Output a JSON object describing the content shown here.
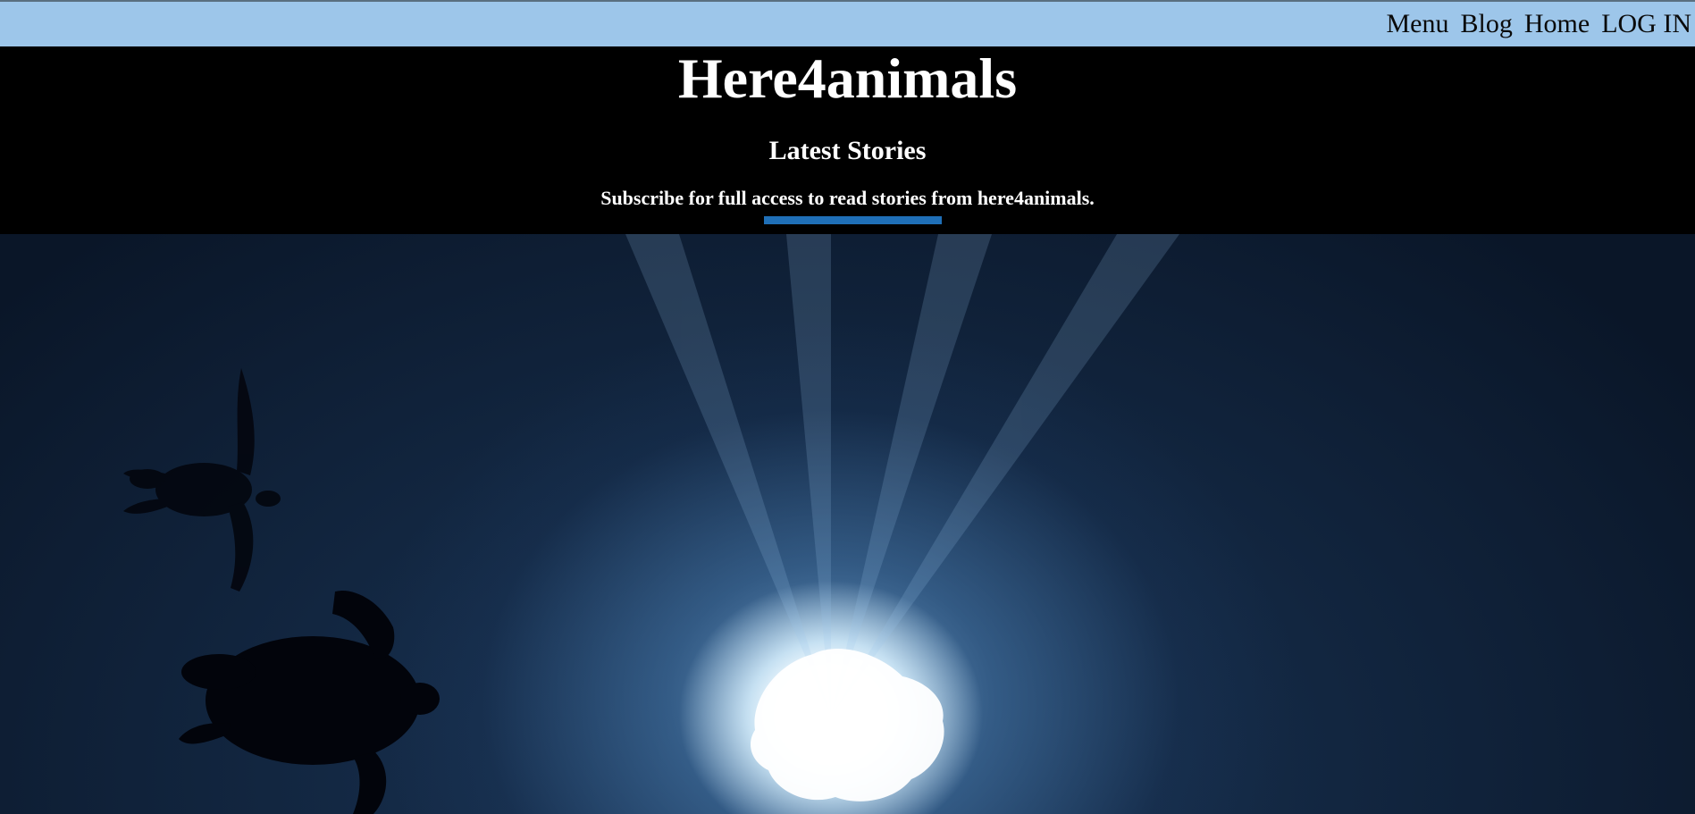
{
  "nav": {
    "items": [
      {
        "label": "Menu"
      },
      {
        "label": "Blog"
      },
      {
        "label": "Home"
      },
      {
        "label": "LOG IN"
      }
    ]
  },
  "header": {
    "site_title": "Here4animals",
    "section_title": "Latest Stories",
    "subscribe_text": "Subscribe for full access to read stories from here4animals."
  },
  "hero": {
    "image_subject": "sea turtles silhouetted against sunlit ocean surface"
  },
  "colors": {
    "nav_background": "#9dc6ea",
    "header_background": "#000000",
    "accent_bar": "#1f6fb7"
  }
}
